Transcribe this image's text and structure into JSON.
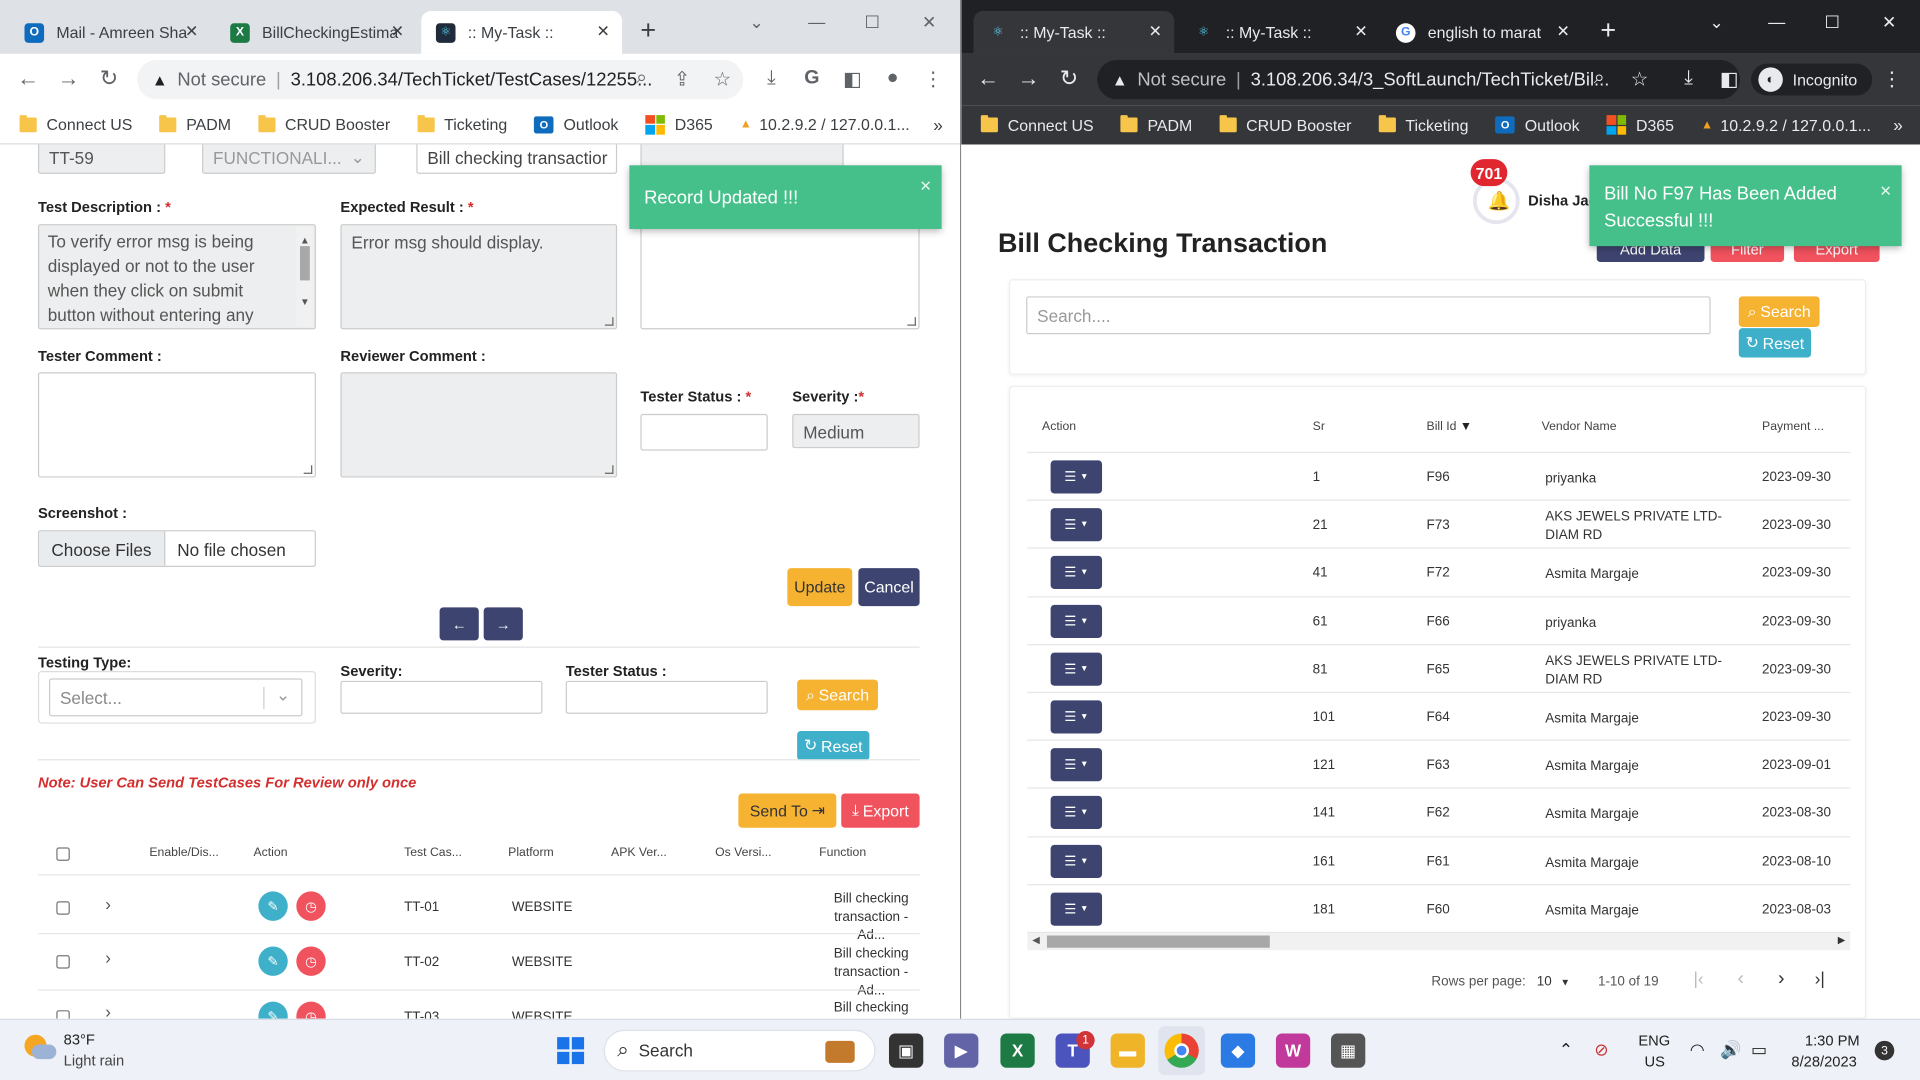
{
  "left_browser": {
    "tabs": [
      {
        "label": "Mail - Amreen Sha",
        "icon": "outlook-icon"
      },
      {
        "label": "BillCheckingEstima",
        "icon": "excel-icon"
      },
      {
        "label": ":: My-Task ::",
        "icon": "react-icon"
      }
    ],
    "address": {
      "not_secure": "Not secure",
      "url": "3.108.206.34/TechTicket/TestCases/12255..."
    },
    "bookmarks": [
      "Connect US",
      "PADM",
      "CRUD Booster",
      "Ticketing",
      "Outlook",
      "D365",
      "10.2.9.2 / 127.0.0.1..."
    ],
    "bookmarks_more": "»",
    "form": {
      "test_id": "TT-59",
      "category": "FUNCTIONALI...",
      "function": "Bill checking transactior",
      "test_description_label": "Test Description :",
      "test_description": "To verify error msg is being displayed or not to the user when they click on submit button without entering any",
      "expected_result_label": "Expected Result :",
      "expected_result": "Error msg should display.",
      "tester_comment_label": "Tester Comment :",
      "reviewer_comment_label": "Reviewer Comment :",
      "tester_status_label": "Tester Status :",
      "severity_label": "Severity :",
      "severity_value": "Medium",
      "screenshot_label": "Screenshot :",
      "choose_files": "Choose Files",
      "no_file": "No file chosen",
      "update": "Update",
      "cancel": "Cancel",
      "required_mark": "*"
    },
    "toast": "Record Updated !!!",
    "filters": {
      "testing_type_label": "Testing Type:",
      "testing_type_placeholder": "Select...",
      "severity_label": "Severity:",
      "tester_status_label": "Tester Status :",
      "search": "Search",
      "reset": "Reset"
    },
    "note": "Note: User Can Send TestCases For Review only once",
    "send_to": "Send To",
    "export": "Export",
    "table": {
      "headers": [
        "Enable/Dis...",
        "Action",
        "Test Cas...",
        "Platform",
        "APK Ver...",
        "Os Versi...",
        "Function"
      ],
      "rows": [
        {
          "id": "TT-01",
          "platform": "WEBSITE",
          "function": "Bill checking transaction - Ad..."
        },
        {
          "id": "TT-02",
          "platform": "WEBSITE",
          "function": "Bill checking transaction - Ad..."
        },
        {
          "id": "TT-03",
          "platform": "WEBSITE",
          "function": "Bill checking"
        }
      ]
    }
  },
  "right_browser": {
    "tabs": [
      {
        "label": ":: My-Task ::",
        "icon": "react-icon"
      },
      {
        "label": ":: My-Task ::",
        "icon": "react-icon"
      },
      {
        "label": "english to marat",
        "icon": "google-icon"
      }
    ],
    "address": {
      "not_secure": "Not secure",
      "url": "3.108.206.34/3_SoftLaunch/TechTicket/Bil..."
    },
    "incognito": "Incognito",
    "bookmarks": [
      "Connect US",
      "PADM",
      "CRUD Booster",
      "Ticketing",
      "Outlook",
      "D365",
      "10.2.9.2 / 127.0.0.1..."
    ],
    "bookmarks_more": "»",
    "notification_count": "701",
    "user_name": "Disha Jad",
    "toast": "Bill No F97 Has Been Added Successful !!!",
    "page_title": "Bill Checking Transaction",
    "buttons": {
      "add_data": "Add Data",
      "filter": "Filter",
      "export": "Export"
    },
    "search_placeholder": "Search....",
    "search": "Search",
    "reset": "Reset",
    "table": {
      "headers": [
        "Action",
        "Sr",
        "Bill Id",
        "Vendor Name",
        "Payment ..."
      ],
      "rows": [
        {
          "sr": "1",
          "bill": "F96",
          "vendor": "priyanka",
          "date": "2023-09-30"
        },
        {
          "sr": "21",
          "bill": "F73",
          "vendor": "AKS JEWELS PRIVATE LTD-DIAM RD",
          "date": "2023-09-30"
        },
        {
          "sr": "41",
          "bill": "F72",
          "vendor": "Asmita Margaje",
          "date": "2023-09-30"
        },
        {
          "sr": "61",
          "bill": "F66",
          "vendor": "priyanka",
          "date": "2023-09-30"
        },
        {
          "sr": "81",
          "bill": "F65",
          "vendor": "AKS JEWELS PRIVATE LTD-DIAM RD",
          "date": "2023-09-30"
        },
        {
          "sr": "101",
          "bill": "F64",
          "vendor": "Asmita Margaje",
          "date": "2023-09-30"
        },
        {
          "sr": "121",
          "bill": "F63",
          "vendor": "Asmita Margaje",
          "date": "2023-09-01"
        },
        {
          "sr": "141",
          "bill": "F62",
          "vendor": "Asmita Margaje",
          "date": "2023-08-30"
        },
        {
          "sr": "161",
          "bill": "F61",
          "vendor": "Asmita Margaje",
          "date": "2023-08-10"
        },
        {
          "sr": "181",
          "bill": "F60",
          "vendor": "Asmita Margaje",
          "date": "2023-08-03"
        }
      ]
    },
    "pagination": {
      "rows_per_page_label": "Rows per page:",
      "rows_per_page": "10",
      "range": "1-10 of 19"
    }
  },
  "taskbar": {
    "weather_temp": "83°F",
    "weather_desc": "Light rain",
    "search": "Search",
    "teams_badge": "1",
    "lang1": "ENG",
    "lang2": "US",
    "time": "1:30 PM",
    "date": "8/28/2023",
    "notif_count": "3"
  },
  "colors": {
    "toast_green": "#45c08a",
    "navy": "#3e4470",
    "warning": "#f6b332",
    "info": "#3fb0c9",
    "danger": "#f0525e",
    "note_red": "#d32f2f"
  }
}
